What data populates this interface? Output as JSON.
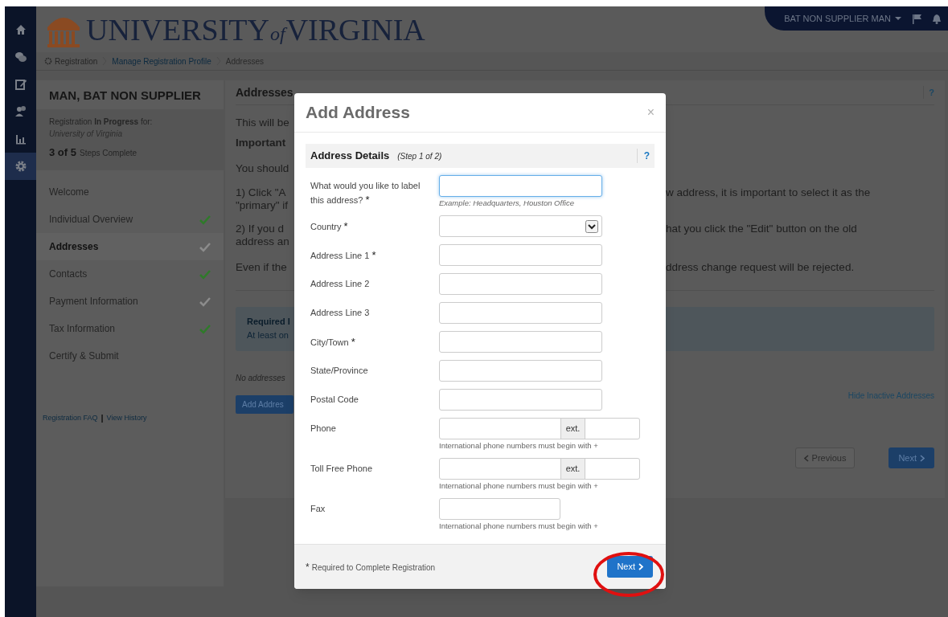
{
  "nav_rail": [
    {
      "selected": false
    },
    {
      "selected": false
    },
    {
      "selected": false
    },
    {
      "selected": false
    },
    {
      "selected": false
    },
    {
      "selected": true
    }
  ],
  "header": {
    "logo_words": [
      "UNIVERSITY",
      "of",
      "VIRGINIA"
    ],
    "user_menu": "BAT NON SUPPLIER MAN"
  },
  "breadcrumb": [
    {
      "label": "Registration",
      "kind": "root"
    },
    {
      "label": "Manage Registration Profile",
      "kind": "link"
    },
    {
      "label": "Addresses",
      "kind": "current"
    }
  ],
  "sidebar": {
    "name": "MAN, BAT NON SUPPLIER",
    "status": "Registration **In Progress** for:",
    "organization": "University of Virginia",
    "progress_count": "3 of 5",
    "progress_label": "Steps Complete",
    "steps": [
      {
        "label": "Welcome",
        "selected": false
      },
      {
        "label": "Individual Overview",
        "selected": false,
        "complete": true
      },
      {
        "label": "Addresses",
        "selected": true,
        "complete": false
      },
      {
        "label": "Contacts",
        "selected": false,
        "complete": true
      },
      {
        "label": "Payment Information",
        "selected": false,
        "complete": false
      },
      {
        "label": "Tax Information",
        "selected": false,
        "complete": true
      },
      {
        "label": "Certify & Submit",
        "selected": false
      }
    ],
    "links": [
      "Registration FAQ",
      "View History"
    ],
    "link_separator": "|"
  },
  "main": {
    "title": "Addresses",
    "help": "?",
    "lines": [
      {
        "left": "This will be"
      },
      {
        "left": "Important",
        "bold": true
      },
      {
        "left": "You should"
      },
      {
        "left": "1) Click \"A",
        "right": "w address, it is important to select it as the"
      },
      {
        "left": "\"primary\" if"
      },
      {
        "left": "2) If you d",
        "right": "hat you click the \"Edit\" button on the old"
      },
      {
        "left": "address an"
      },
      {
        "left": "Even if the",
        "right": "ddress change request will be rejected."
      }
    ],
    "notice": {
      "title": "Required I",
      "text": "At least on"
    },
    "empty_text": "No addresses",
    "add_button": "Add Addres",
    "hide_link": "Hide Inactive Addresses",
    "previous_button": "Previous",
    "next_button": "Next"
  },
  "modal": {
    "title": "Add Address",
    "close": "×",
    "section_title": "Address Details",
    "section_step": "(Step 1 of 2)",
    "help": "?",
    "required_mark": "*",
    "fields": [
      {
        "kind": "text",
        "label": "What would you like to label this address?",
        "required": true,
        "focused": true,
        "hint": "Example: Headquarters, Houston Office"
      },
      {
        "kind": "select",
        "label": "Country",
        "required": true,
        "focused": false
      },
      {
        "kind": "text",
        "label": "Address Line 1",
        "required": true,
        "focused": false
      },
      {
        "kind": "text",
        "label": "Address Line 2",
        "required": false,
        "focused": false
      },
      {
        "kind": "text",
        "label": "Address Line 3",
        "required": false,
        "focused": false
      },
      {
        "kind": "text",
        "label": "City/Town",
        "required": true,
        "focused": false
      },
      {
        "kind": "text",
        "label": "State/Province",
        "required": false,
        "focused": false
      },
      {
        "kind": "text",
        "label": "Postal Code",
        "required": false,
        "focused": false
      },
      {
        "kind": "phone",
        "label": "Phone",
        "required": false,
        "focused": false,
        "ext": "ext.",
        "hint": "International phone numbers must begin with +"
      },
      {
        "kind": "phone",
        "label": "Toll Free Phone",
        "required": false,
        "focused": false,
        "ext": "ext.",
        "hint": "International phone numbers must begin with +"
      },
      {
        "kind": "short",
        "label": "Fax",
        "required": false,
        "focused": false,
        "hint": "International phone numbers must begin with +"
      }
    ],
    "footer_note": "Required to Complete Registration",
    "next_button": "Next"
  }
}
